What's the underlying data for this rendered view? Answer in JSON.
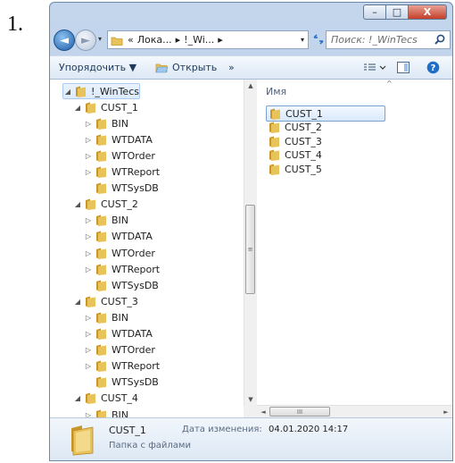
{
  "step_number": "1.",
  "window": {
    "minimize_glyph": "–",
    "maximize_glyph": "□",
    "close_glyph": "X"
  },
  "address": {
    "back_glyph": "◄",
    "forward_glyph": "►",
    "segments": [
      "«",
      "Лока...",
      "▸",
      "!_Wi...",
      "▸"
    ],
    "dropdown_glyph": "▾",
    "search_placeholder": "Поиск: !_WinTecs"
  },
  "toolbar": {
    "organize": "Упорядочить ▼",
    "open": "Открыть",
    "more": "»"
  },
  "tree": [
    {
      "label": "!_WinTecs",
      "level": 0,
      "expand": "open",
      "selected": true
    },
    {
      "label": "CUST_1",
      "level": 1,
      "expand": "open"
    },
    {
      "label": "BIN",
      "level": 2,
      "expand": "closed"
    },
    {
      "label": "WTDATA",
      "level": 2,
      "expand": "closed"
    },
    {
      "label": "WTOrder",
      "level": 2,
      "expand": "closed"
    },
    {
      "label": "WTReport",
      "level": 2,
      "expand": "closed"
    },
    {
      "label": "WTSysDB",
      "level": 2,
      "expand": "none"
    },
    {
      "label": "CUST_2",
      "level": 1,
      "expand": "open"
    },
    {
      "label": "BIN",
      "level": 2,
      "expand": "closed"
    },
    {
      "label": "WTDATA",
      "level": 2,
      "expand": "closed"
    },
    {
      "label": "WTOrder",
      "level": 2,
      "expand": "closed"
    },
    {
      "label": "WTReport",
      "level": 2,
      "expand": "closed"
    },
    {
      "label": "WTSysDB",
      "level": 2,
      "expand": "none"
    },
    {
      "label": "CUST_3",
      "level": 1,
      "expand": "open"
    },
    {
      "label": "BIN",
      "level": 2,
      "expand": "closed"
    },
    {
      "label": "WTDATA",
      "level": 2,
      "expand": "closed"
    },
    {
      "label": "WTOrder",
      "level": 2,
      "expand": "closed"
    },
    {
      "label": "WTReport",
      "level": 2,
      "expand": "closed"
    },
    {
      "label": "WTSysDB",
      "level": 2,
      "expand": "none"
    },
    {
      "label": "CUST_4",
      "level": 1,
      "expand": "open"
    },
    {
      "label": "BIN",
      "level": 2,
      "expand": "closed"
    }
  ],
  "scroll": {
    "up": "▲",
    "down": "▼",
    "left": "◄",
    "right": "►",
    "grip_v": "≡",
    "grip_h": "III"
  },
  "content": {
    "column_name": "Имя",
    "sort_glyph": "^",
    "files": [
      {
        "name": "CUST_1",
        "selected": true
      },
      {
        "name": "CUST_2",
        "selected": false
      },
      {
        "name": "CUST_3",
        "selected": false
      },
      {
        "name": "CUST_4",
        "selected": false
      },
      {
        "name": "CUST_5",
        "selected": false
      }
    ]
  },
  "details": {
    "name": "CUST_1",
    "type": "Папка с файлами",
    "date_label": "Дата изменения:",
    "date_value": "04.01.2020 14:17"
  },
  "colors": {
    "folder": "#e8c35a",
    "folder_dark": "#c9962c",
    "selection": "#dceafb"
  }
}
